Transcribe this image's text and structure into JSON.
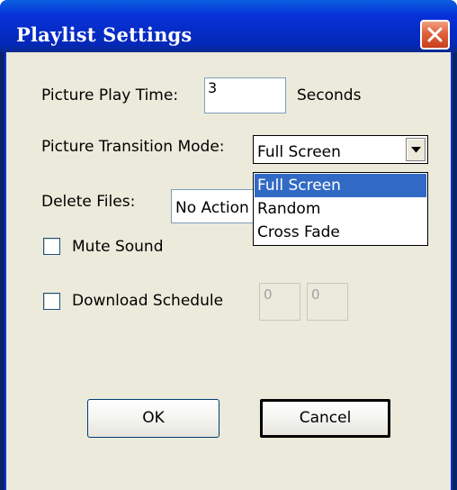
{
  "window": {
    "title": "Playlist Settings"
  },
  "picture_play_time": {
    "label": "Picture Play Time:",
    "value": "3",
    "unit": "Seconds"
  },
  "picture_transition_mode": {
    "label": "Picture Transition Mode:",
    "selected": "Full Screen",
    "options": [
      "Full Screen",
      "Random",
      "Cross Fade"
    ],
    "highlighted_option": "Full Screen"
  },
  "delete_files": {
    "label": "Delete Files:",
    "selected": "No Action"
  },
  "mute_sound": {
    "label": "Mute Sound",
    "checked": false
  },
  "download_schedule": {
    "label": "Download Schedule",
    "checked": false,
    "start_value": "0",
    "end_value": "0"
  },
  "buttons": {
    "ok_label": "OK",
    "cancel_label": "Cancel"
  },
  "colors": {
    "titlebar": "#0831d9",
    "dialog_background": "#ebeadb",
    "selection_highlight": "#316ac5",
    "close_button": "#e0623c"
  },
  "icons": {
    "close": "close-icon",
    "dropdown_arrow": "chevron-down-icon"
  }
}
